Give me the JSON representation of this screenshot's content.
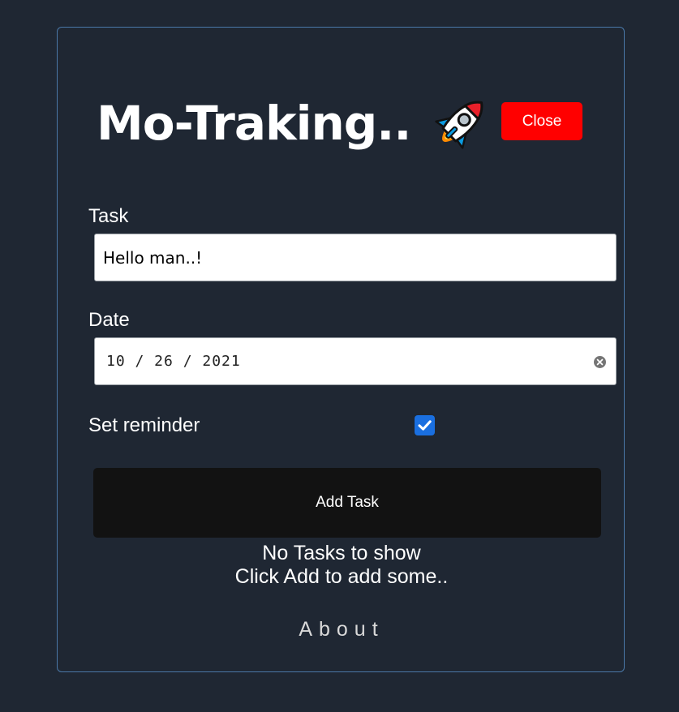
{
  "header": {
    "title": "Mo-Traking..",
    "rocket_icon": "rocket-emoji",
    "close_label": "Close",
    "close_color": "#ff0000"
  },
  "form": {
    "task_label": "Task",
    "task_value": "Hello man..!",
    "date_label": "Date",
    "date_value": "10 / 26 / 2021",
    "reminder_label": "Set reminder",
    "reminder_checked": true,
    "add_label": "Add Task"
  },
  "tasks": {
    "empty_line1": "No Tasks to show",
    "empty_line2": "Click Add to add some.."
  },
  "footer": {
    "about_label": "About"
  },
  "colors": {
    "background": "#1f2733",
    "accent": "#1a6fe0",
    "border": "#4a78a8"
  }
}
